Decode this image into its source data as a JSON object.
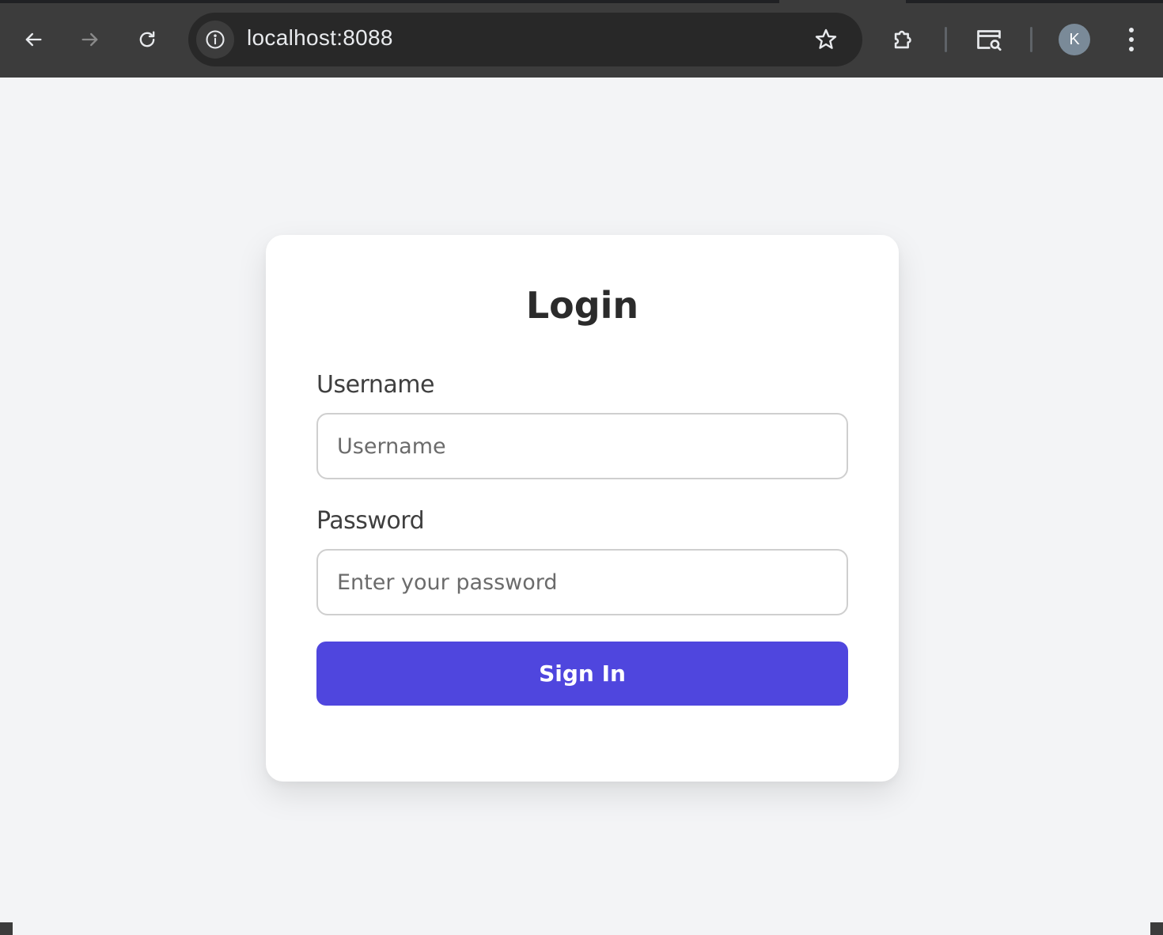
{
  "browser": {
    "url": "localhost:8088",
    "profile_initial": "K",
    "icons": {
      "back": "arrow-left-icon",
      "forward": "arrow-right-icon",
      "reload": "reload-icon",
      "site_info": "info-icon",
      "bookmark": "star-icon",
      "extensions": "puzzle-icon",
      "search_tab": "tab-search-icon",
      "menu": "kebab-menu-icon"
    }
  },
  "login": {
    "title": "Login",
    "username_label": "Username",
    "username_placeholder": "Username",
    "username_value": "",
    "password_label": "Password",
    "password_placeholder": "Enter your password",
    "password_value": "",
    "submit_label": "Sign In"
  },
  "colors": {
    "page_background": "#f3f4f6",
    "card_background": "#ffffff",
    "primary_button": "#4f46de",
    "browser_chrome": "#3c3c3c"
  }
}
